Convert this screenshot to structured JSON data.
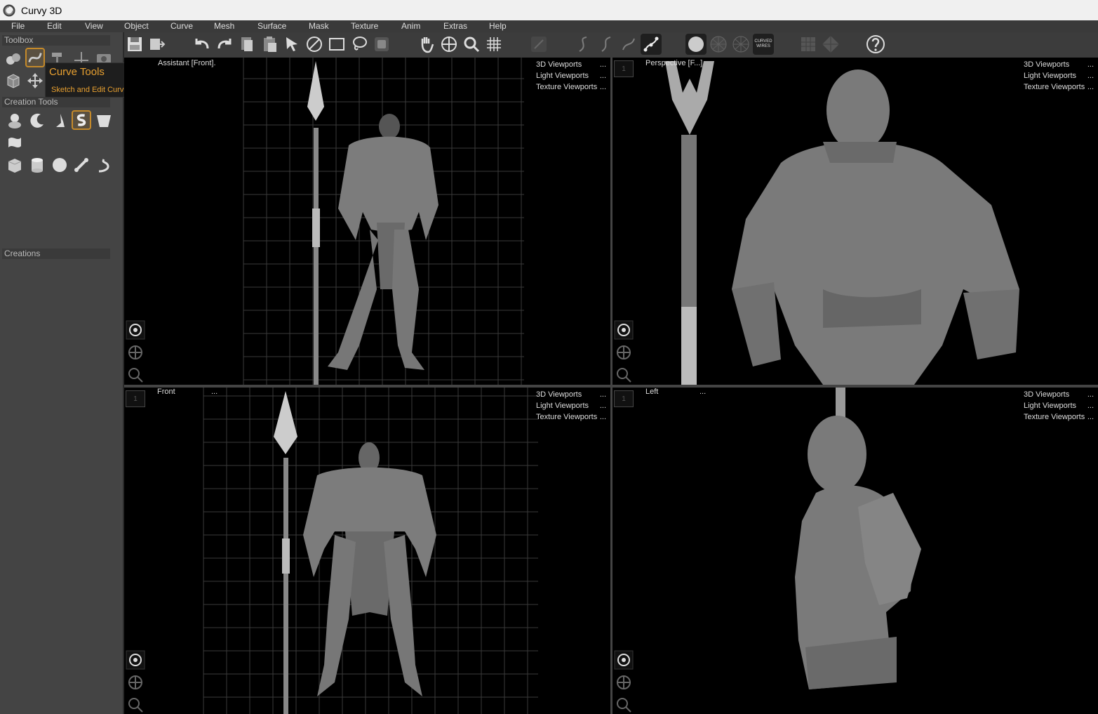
{
  "window": {
    "title": "Curvy 3D"
  },
  "menu": [
    "File",
    "Edit",
    "View",
    "Object",
    "Curve",
    "Mesh",
    "Surface",
    "Mask",
    "Texture",
    "Anim",
    "Extras",
    "Help"
  ],
  "left_panel": {
    "toolbox_label": "Toolbox",
    "creation_tools_label": "Creation Tools",
    "creations_label": "Creations",
    "tooltip": {
      "title": "Curve Tools",
      "description": "Sketch and Edit Curves."
    }
  },
  "toolbar": {
    "curved_wires_label": "CURVED\nWIRES"
  },
  "viewports": {
    "top_left": {
      "title": "Assistant [Front].",
      "menu": [
        "3D Viewports",
        "Light Viewports",
        "Texture Viewports"
      ],
      "menu_dots": [
        "...",
        "...",
        "..."
      ]
    },
    "top_right": {
      "title": "Perspective [F...]",
      "badge": "1",
      "menu": [
        "3D Viewports",
        "Light Viewports",
        "Texture Viewports"
      ],
      "menu_dots": [
        "...",
        "...",
        "..."
      ]
    },
    "bottom_left": {
      "title": "Front",
      "dots": "...",
      "badge": "1",
      "menu": [
        "3D Viewports",
        "Light Viewports",
        "Texture Viewports"
      ],
      "menu_dots": [
        "...",
        "...",
        "..."
      ]
    },
    "bottom_right": {
      "title": "Left",
      "dots": "...",
      "badge": "1",
      "menu": [
        "3D Viewports",
        "Light Viewports",
        "Texture Viewports"
      ],
      "menu_dots": [
        "...",
        "...",
        "..."
      ]
    }
  },
  "colors": {
    "accent": "#e8a030",
    "panel": "#444444",
    "viewport_bg": "#000000",
    "grid": "#555555",
    "model": "#8a8a8a"
  }
}
